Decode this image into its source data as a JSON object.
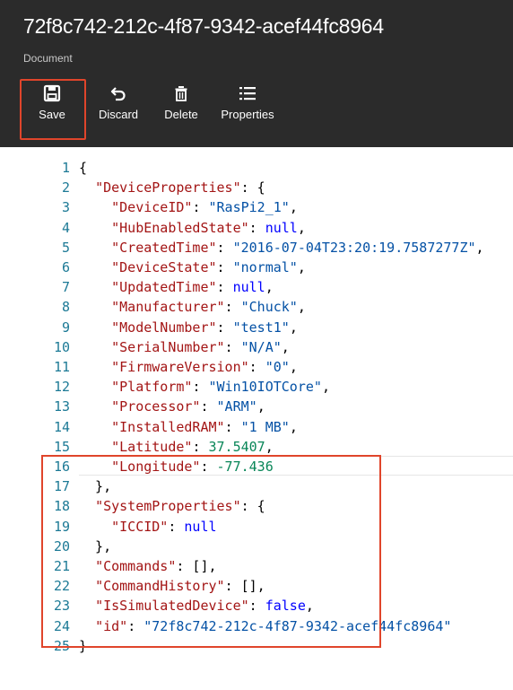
{
  "document": {
    "title": "72f8c742-212c-4f87-9342-acef44fc8964",
    "subtitle": "Document"
  },
  "toolbar": {
    "save_label": "Save",
    "discard_label": "Discard",
    "delete_label": "Delete",
    "properties_label": "Properties",
    "save_icon": "save-icon",
    "discard_icon": "undo-icon",
    "delete_icon": "trash-icon",
    "properties_icon": "list-icon"
  },
  "colors": {
    "header_bg": "#2b2b2b",
    "highlight": "#e0452b",
    "line_number": "#1d7a96",
    "key": "#a31515",
    "string": "#0451a5",
    "number": "#098658",
    "keyword": "#0000ff"
  },
  "code": {
    "lines": [
      {
        "n": "1",
        "parts": [
          {
            "t": "{",
            "c": "p"
          }
        ]
      },
      {
        "n": "2",
        "parts": [
          {
            "t": "  ",
            "c": "p"
          },
          {
            "t": "\"DeviceProperties\"",
            "c": "k"
          },
          {
            "t": ": {",
            "c": "p"
          }
        ]
      },
      {
        "n": "3",
        "parts": [
          {
            "t": "    ",
            "c": "p"
          },
          {
            "t": "\"DeviceID\"",
            "c": "k"
          },
          {
            "t": ": ",
            "c": "p"
          },
          {
            "t": "\"RasPi2_1\"",
            "c": "s"
          },
          {
            "t": ",",
            "c": "p"
          }
        ]
      },
      {
        "n": "4",
        "parts": [
          {
            "t": "    ",
            "c": "p"
          },
          {
            "t": "\"HubEnabledState\"",
            "c": "k"
          },
          {
            "t": ": ",
            "c": "p"
          },
          {
            "t": "null",
            "c": "kw"
          },
          {
            "t": ",",
            "c": "p"
          }
        ]
      },
      {
        "n": "5",
        "parts": [
          {
            "t": "    ",
            "c": "p"
          },
          {
            "t": "\"CreatedTime\"",
            "c": "k"
          },
          {
            "t": ": ",
            "c": "p"
          },
          {
            "t": "\"2016-07-04T23:20:19.7587277Z\"",
            "c": "s"
          },
          {
            "t": ",",
            "c": "p"
          }
        ]
      },
      {
        "n": "6",
        "parts": [
          {
            "t": "    ",
            "c": "p"
          },
          {
            "t": "\"DeviceState\"",
            "c": "k"
          },
          {
            "t": ": ",
            "c": "p"
          },
          {
            "t": "\"normal\"",
            "c": "s"
          },
          {
            "t": ",",
            "c": "p"
          }
        ]
      },
      {
        "n": "7",
        "parts": [
          {
            "t": "    ",
            "c": "p"
          },
          {
            "t": "\"UpdatedTime\"",
            "c": "k"
          },
          {
            "t": ": ",
            "c": "p"
          },
          {
            "t": "null",
            "c": "kw"
          },
          {
            "t": ",",
            "c": "p"
          }
        ]
      },
      {
        "n": "8",
        "parts": [
          {
            "t": "    ",
            "c": "p"
          },
          {
            "t": "\"Manufacturer\"",
            "c": "k"
          },
          {
            "t": ": ",
            "c": "p"
          },
          {
            "t": "\"Chuck\"",
            "c": "s"
          },
          {
            "t": ",",
            "c": "p"
          }
        ]
      },
      {
        "n": "9",
        "parts": [
          {
            "t": "    ",
            "c": "p"
          },
          {
            "t": "\"ModelNumber\"",
            "c": "k"
          },
          {
            "t": ": ",
            "c": "p"
          },
          {
            "t": "\"test1\"",
            "c": "s"
          },
          {
            "t": ",",
            "c": "p"
          }
        ]
      },
      {
        "n": "10",
        "parts": [
          {
            "t": "    ",
            "c": "p"
          },
          {
            "t": "\"SerialNumber\"",
            "c": "k"
          },
          {
            "t": ": ",
            "c": "p"
          },
          {
            "t": "\"N/A\"",
            "c": "s"
          },
          {
            "t": ",",
            "c": "p"
          }
        ]
      },
      {
        "n": "11",
        "parts": [
          {
            "t": "    ",
            "c": "p"
          },
          {
            "t": "\"FirmwareVersion\"",
            "c": "k"
          },
          {
            "t": ": ",
            "c": "p"
          },
          {
            "t": "\"0\"",
            "c": "s"
          },
          {
            "t": ",",
            "c": "p"
          }
        ]
      },
      {
        "n": "12",
        "parts": [
          {
            "t": "    ",
            "c": "p"
          },
          {
            "t": "\"Platform\"",
            "c": "k"
          },
          {
            "t": ": ",
            "c": "p"
          },
          {
            "t": "\"Win10IOTCore\"",
            "c": "s"
          },
          {
            "t": ",",
            "c": "p"
          }
        ]
      },
      {
        "n": "13",
        "parts": [
          {
            "t": "    ",
            "c": "p"
          },
          {
            "t": "\"Processor\"",
            "c": "k"
          },
          {
            "t": ": ",
            "c": "p"
          },
          {
            "t": "\"ARM\"",
            "c": "s"
          },
          {
            "t": ",",
            "c": "p"
          }
        ]
      },
      {
        "n": "14",
        "parts": [
          {
            "t": "    ",
            "c": "p"
          },
          {
            "t": "\"InstalledRAM\"",
            "c": "k"
          },
          {
            "t": ": ",
            "c": "p"
          },
          {
            "t": "\"1 MB\"",
            "c": "s"
          },
          {
            "t": ",",
            "c": "p"
          }
        ]
      },
      {
        "n": "15",
        "parts": [
          {
            "t": "    ",
            "c": "p"
          },
          {
            "t": "\"Latitude\"",
            "c": "k"
          },
          {
            "t": ": ",
            "c": "p"
          },
          {
            "t": "37.5407",
            "c": "n"
          },
          {
            "t": ",",
            "c": "p"
          }
        ]
      },
      {
        "n": "16",
        "parts": [
          {
            "t": "    ",
            "c": "p"
          },
          {
            "t": "\"Longitude\"",
            "c": "k"
          },
          {
            "t": ": ",
            "c": "p"
          },
          {
            "t": "-77.436",
            "c": "n"
          }
        ]
      },
      {
        "n": "17",
        "parts": [
          {
            "t": "  },",
            "c": "p"
          }
        ]
      },
      {
        "n": "18",
        "parts": [
          {
            "t": "  ",
            "c": "p"
          },
          {
            "t": "\"SystemProperties\"",
            "c": "k"
          },
          {
            "t": ": {",
            "c": "p"
          }
        ]
      },
      {
        "n": "19",
        "parts": [
          {
            "t": "    ",
            "c": "p"
          },
          {
            "t": "\"ICCID\"",
            "c": "k"
          },
          {
            "t": ": ",
            "c": "p"
          },
          {
            "t": "null",
            "c": "kw"
          }
        ]
      },
      {
        "n": "20",
        "parts": [
          {
            "t": "  },",
            "c": "p"
          }
        ]
      },
      {
        "n": "21",
        "parts": [
          {
            "t": "  ",
            "c": "p"
          },
          {
            "t": "\"Commands\"",
            "c": "k"
          },
          {
            "t": ": [],",
            "c": "p"
          }
        ]
      },
      {
        "n": "22",
        "parts": [
          {
            "t": "  ",
            "c": "p"
          },
          {
            "t": "\"CommandHistory\"",
            "c": "k"
          },
          {
            "t": ": [],",
            "c": "p"
          }
        ]
      },
      {
        "n": "23",
        "parts": [
          {
            "t": "  ",
            "c": "p"
          },
          {
            "t": "\"IsSimulatedDevice\"",
            "c": "k"
          },
          {
            "t": ": ",
            "c": "p"
          },
          {
            "t": "false",
            "c": "kw"
          },
          {
            "t": ",",
            "c": "p"
          }
        ]
      },
      {
        "n": "24",
        "parts": [
          {
            "t": "  ",
            "c": "p"
          },
          {
            "t": "\"id\"",
            "c": "k"
          },
          {
            "t": ": ",
            "c": "p"
          },
          {
            "t": "\"72f8c742-212c-4f87-9342-acef44fc8964\"",
            "c": "s"
          }
        ]
      },
      {
        "n": "25",
        "parts": [
          {
            "t": "}",
            "c": "p"
          }
        ]
      }
    ]
  }
}
